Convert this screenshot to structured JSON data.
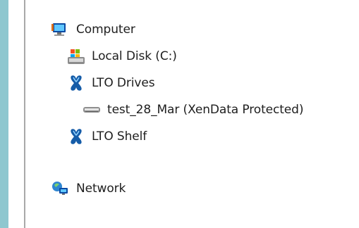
{
  "tree": {
    "items": [
      {
        "label": "Computer",
        "icon": "computer-icon"
      },
      {
        "label": "Local Disk (C:)",
        "icon": "local-disk-icon"
      },
      {
        "label": "LTO Drives",
        "icon": "lto-drive-icon"
      },
      {
        "label": "test_28_Mar (XenData Protected)",
        "icon": "tape-drive-icon"
      },
      {
        "label": "LTO Shelf",
        "icon": "lto-shelf-icon"
      },
      {
        "label": "Network",
        "icon": "network-icon"
      }
    ]
  }
}
